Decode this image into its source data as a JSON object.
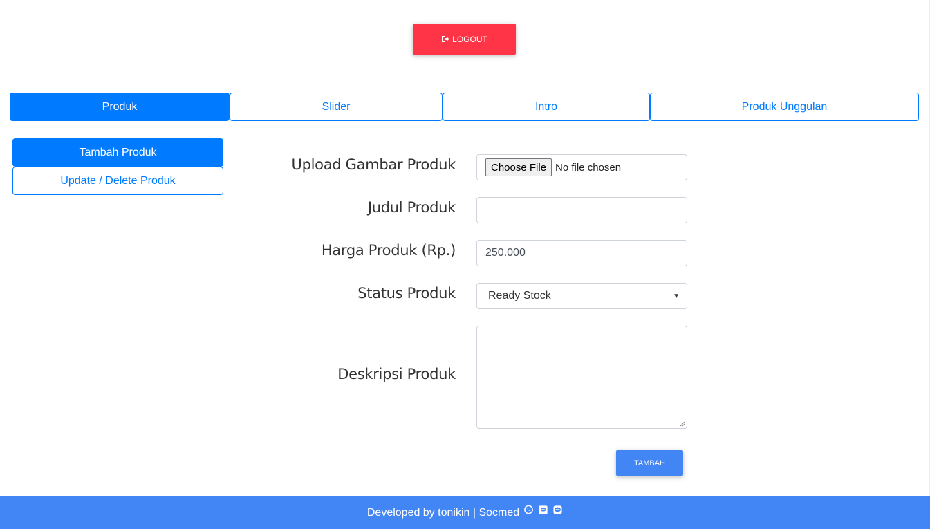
{
  "header": {
    "logout_label": "LOGOUT"
  },
  "tabs": [
    {
      "label": "Produk",
      "active": true
    },
    {
      "label": "Slider",
      "active": false
    },
    {
      "label": "Intro",
      "active": false
    },
    {
      "label": "Produk Unggulan",
      "active": false
    }
  ],
  "sidebar": {
    "add_label": "Tambah Produk",
    "update_label": "Update / Delete Produk"
  },
  "form": {
    "image_label": "Upload Gambar Produk",
    "choose_file_label": "Choose File",
    "no_file_text": "No file chosen",
    "title_label": "Judul Produk",
    "title_value": "",
    "price_label": "Harga Produk (Rp.)",
    "price_value": "250.000",
    "status_label": "Status Produk",
    "status_value": "Ready Stock",
    "description_label": "Deskripsi Produk",
    "description_value": "",
    "submit_label": "TAMBAH"
  },
  "footer": {
    "text": "Developed by tonikin | Socmed",
    "icons": [
      "whatsapp-icon",
      "discord-icon",
      "line-icon"
    ]
  },
  "colors": {
    "primary": "#007bff",
    "danger": "#ff3547",
    "footer": "#4285f4"
  }
}
